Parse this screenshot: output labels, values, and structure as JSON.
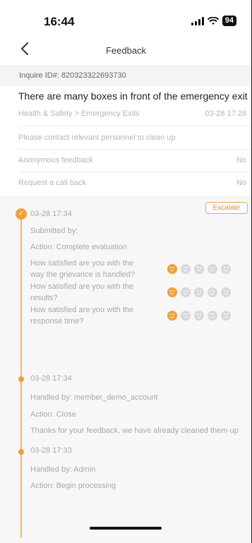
{
  "status": {
    "time": "16:44",
    "battery": "94"
  },
  "nav": {
    "title": "Feedback"
  },
  "inquire": "Inquire ID#: 820323322693730",
  "feedback": {
    "title": "There are many boxes in front of the emergency exit",
    "category": "Health & Safety > Emergency Exits",
    "date": "03-28 17:26",
    "description": "Please contact relevant personnel to clean up",
    "anonymous_label": "Anonymous feedback",
    "anonymous_value": "No",
    "callback_label": "Request a call back",
    "callback_value": "No"
  },
  "escalate_label": "Escalate",
  "timeline": [
    {
      "time": "03-28 17:34",
      "by": "Submitted by:",
      "action": "Action: Complete evaluation",
      "ratings": [
        {
          "question": "How satisfied are you with the way the grievance is handled?",
          "score": 1
        },
        {
          "question": "How satisfied are you with the results?",
          "score": 1
        },
        {
          "question": "How satisfied are you with the response time?",
          "score": 1
        }
      ]
    },
    {
      "time": "03-28 17:34",
      "by": "Handled by: member_demo_account",
      "action": "Action: Close",
      "note": "Thanks for your feedback, we have already cleaned them up"
    },
    {
      "time": "03-28 17:33",
      "by": "Handled by: Admin",
      "action": "Action: Begin processing"
    }
  ],
  "colors": {
    "accent": "#f0a03a",
    "escalate": "#e58a32"
  }
}
